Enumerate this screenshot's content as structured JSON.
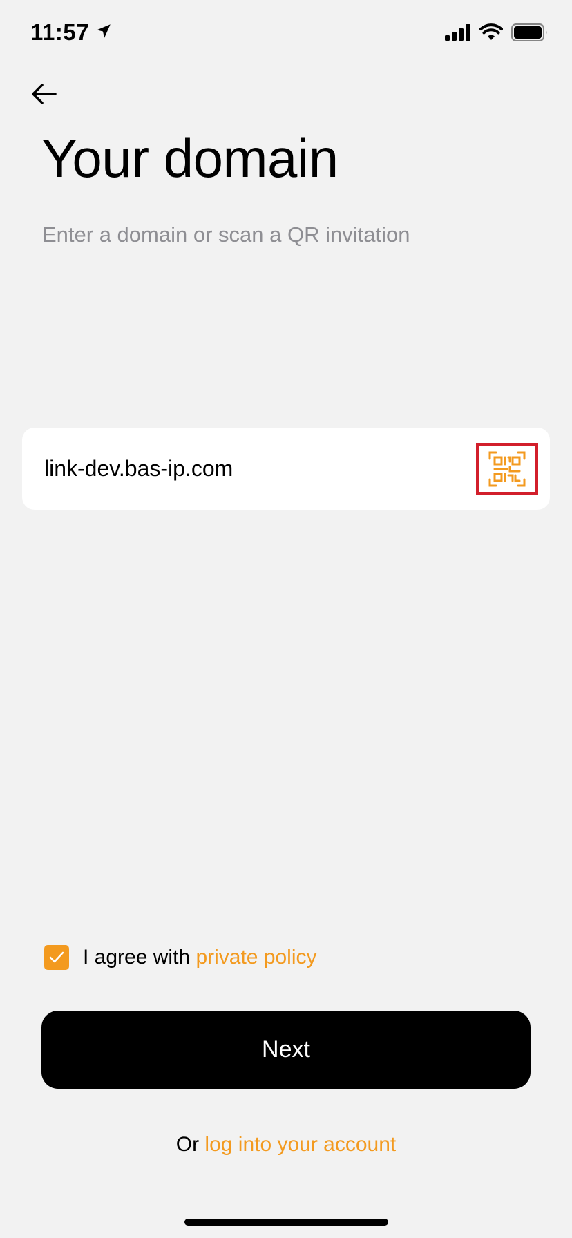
{
  "status_bar": {
    "time": "11:57",
    "location_icon": "location-arrow-icon",
    "signal_icon": "cellular-signal-icon",
    "wifi_icon": "wifi-icon",
    "battery_icon": "battery-icon"
  },
  "header": {
    "back_icon": "arrow-left-icon",
    "title": "Your domain",
    "subtitle": "Enter a domain or scan a QR invitation"
  },
  "domain_field": {
    "value": "link-dev.bas-ip.com",
    "qr_icon": "qr-code-icon"
  },
  "agreement": {
    "checked": true,
    "text": "I agree with",
    "link": "private policy"
  },
  "next_button": {
    "label": "Next"
  },
  "login": {
    "prefix": "Or",
    "link": "log into your account"
  },
  "colors": {
    "accent": "#f39a1f",
    "background": "#f2f2f2",
    "highlight": "#d21f2b"
  }
}
